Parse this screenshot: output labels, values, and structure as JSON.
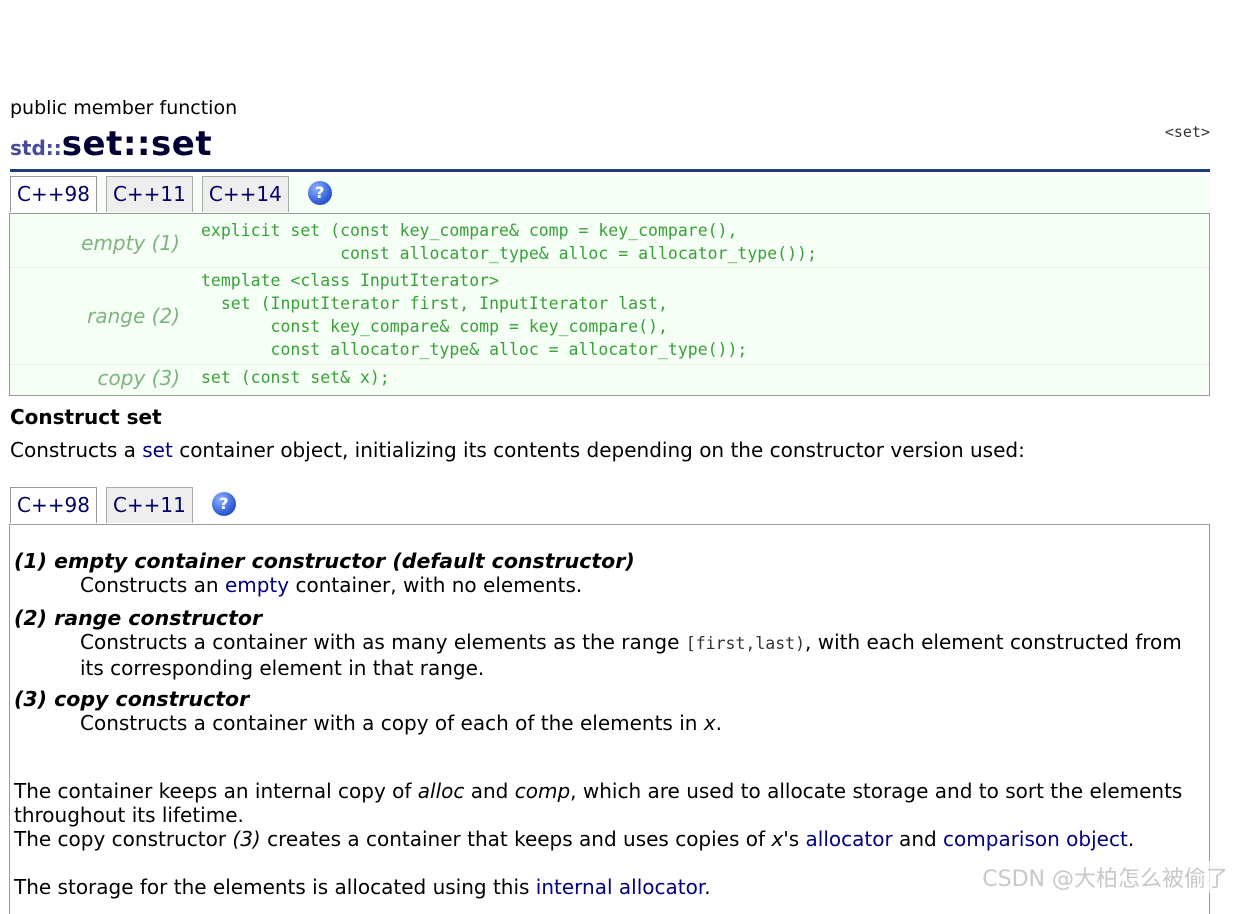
{
  "header": {
    "kind": "public member function",
    "namespace": "std::",
    "name": "set::set",
    "header_ref": "<set>"
  },
  "proto_tabs": {
    "items": [
      "C++98",
      "C++11",
      "C++14"
    ],
    "active_index": 0,
    "help": "?"
  },
  "prototypes": [
    {
      "label": "empty (1)",
      "code": "explicit set (const key_compare& comp = key_compare(),\n              const allocator_type& alloc = allocator_type());"
    },
    {
      "label": "range (2)",
      "code": "template <class InputIterator>\n  set (InputIterator first, InputIterator last,\n       const key_compare& comp = key_compare(),\n       const allocator_type& alloc = allocator_type());"
    },
    {
      "label": "copy (3)",
      "code": "set (const set& x);"
    }
  ],
  "construct": {
    "heading": "Construct set",
    "desc_before": "Constructs a ",
    "desc_link": "set",
    "desc_after": " container object, initializing its contents depending on the constructor version used:"
  },
  "desc_tabs": {
    "items": [
      "C++98",
      "C++11"
    ],
    "active_index": 0,
    "help": "?"
  },
  "descriptions": {
    "d1_term": "(1) empty container constructor (default constructor)",
    "d1_before": "Constructs an ",
    "d1_link": "empty",
    "d1_after": " container, with no elements.",
    "d2_term": "(2) range constructor",
    "d2_before": "Constructs a container with as many elements as the range ",
    "d2_code": "[first,last)",
    "d2_after": ", with each element constructed from its corresponding element in that range.",
    "d3_term": "(3) copy constructor",
    "d3_before": "Constructs a container with a copy of each of the elements in ",
    "d3_var": "x",
    "d3_after": "."
  },
  "para1": {
    "t1": "The container keeps an internal copy of ",
    "alloc": "alloc",
    "t2": " and ",
    "comp": "comp",
    "t3": ", which are used to allocate storage and to sort the elements throughout its lifetime."
  },
  "para2": {
    "t1": "The copy constructor ",
    "ref": "(3)",
    "t2": " creates a container that keeps and uses copies of ",
    "x": "x",
    "t3": "'s ",
    "link1": "allocator",
    "t4": " and ",
    "link2": "comparison object",
    "t5": "."
  },
  "para3": {
    "t1": "The storage for the elements is allocated using this ",
    "link": "internal allocator",
    "t2": "."
  },
  "watermark": "CSDN @大柏怎么被偷了"
}
